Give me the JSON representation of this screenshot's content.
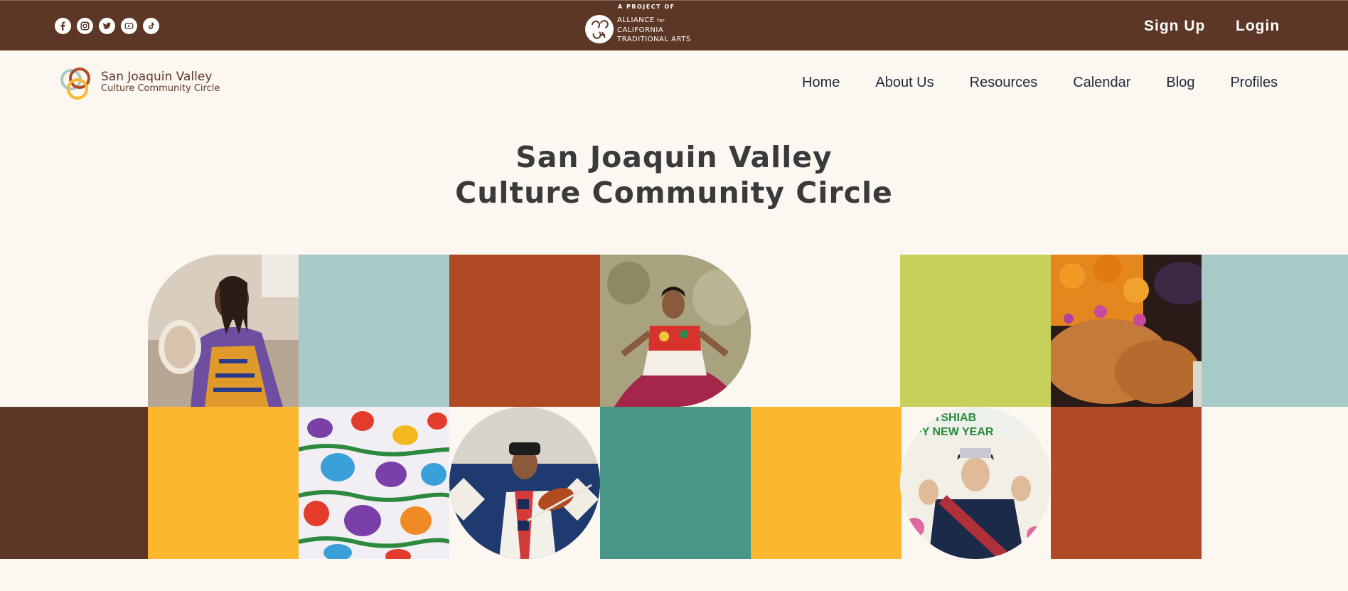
{
  "topbar": {
    "social": [
      "facebook-icon",
      "instagram-icon",
      "twitter-icon",
      "youtube-icon",
      "tiktok-icon"
    ],
    "partner_prefix": "A PROJECT OF",
    "partner_line1": "ALLIANCE",
    "partner_for": "for",
    "partner_line2": "CALIFORNIA",
    "partner_line3": "TRADITIONAL ARTS",
    "signup_label": "Sign Up",
    "login_label": "Login"
  },
  "brand": {
    "line1": "San Joaquin Valley",
    "line2": "Culture Community Circle"
  },
  "nav": {
    "items": [
      "Home",
      "About Us",
      "Resources",
      "Calendar",
      "Blog",
      "Profiles"
    ]
  },
  "hero": {
    "title_line1": "San Joaquin Valley",
    "title_line2": "Culture Community Circle"
  },
  "colors": {
    "brown": "#5c3726",
    "teal_light": "#a7c9c7",
    "rust": "#b04a25",
    "lime": "#c6d05a",
    "gold": "#fcb72f",
    "teal": "#489688",
    "cream": "#fdf7f2"
  }
}
